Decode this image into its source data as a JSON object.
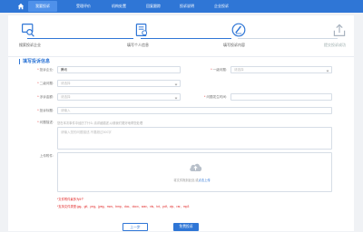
{
  "nav": {
    "items": [
      "我要投诉",
      "受理评价",
      "机构处置",
      "回复跟踪",
      "投诉说明",
      "企业投诉"
    ],
    "active_index": 0
  },
  "steps": [
    {
      "label": "搜索投诉企业",
      "state": "done",
      "icon": "search-company-icon"
    },
    {
      "label": "填写个人信息",
      "state": "done",
      "icon": "personal-info-icon"
    },
    {
      "label": "填写投诉内容",
      "state": "current",
      "icon": "complaint-content-icon"
    },
    {
      "label": "提交投诉成功",
      "state": "pending",
      "icon": "submit-upload-icon"
    }
  ],
  "form": {
    "section_title": "填写投诉信息",
    "company_label": "投诉企业:",
    "company_value": "腾讯",
    "type1_label": "一级问题:",
    "type1_placeholder": "请选择",
    "type2_label": "二级问题:",
    "type2_placeholder": "请选择",
    "amount_label": "涉诉金额:",
    "amount_placeholder": "请选择",
    "order_label": "问题发生时间:",
    "order_placeholder": "",
    "title_label": "投诉标题:",
    "title_placeholder": "请输入",
    "desc_label": "问题描述:",
    "desc_hint": "您在本次事件中经历了什么,请详细描述,以便我们更好地帮您处理",
    "desc_placeholder": "请输入您的问题描述,不要超过500字",
    "attach_label": "上传附件:",
    "upload_text": "将文件拖到此处,或",
    "upload_link": "点击上传",
    "note1": "*文件附件最多为5个",
    "note2": "*支持文件类型:jpg、gif、png、jpeg、mov、bmp、doc、docx、wav、xls、txt、pdf、zip、rar、mp3"
  },
  "buttons": {
    "prev": "上一步",
    "submit": "免费投诉"
  },
  "colors": {
    "accent": "#2f76d6",
    "required": "#e02020"
  }
}
